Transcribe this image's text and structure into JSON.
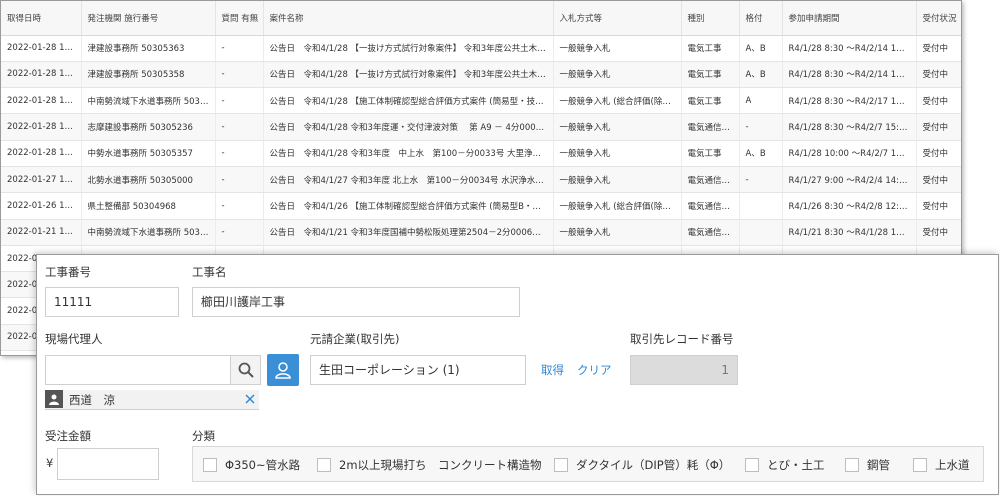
{
  "table": {
    "headers": [
      "取得日時",
      "発注機関 施行番号",
      "質問 有無",
      "案件名称",
      "入札方式等",
      "種別",
      "格付",
      "参加申請期間",
      "受付状況"
    ],
    "rows": [
      [
        "2022-01-28 12:01",
        "津建設事務所 50305363",
        "-",
        "公告日　令和4/1/28 【一抜け方式試行対象案件】 令和3年度公共土木施設維…",
        "一般競争入札",
        "電気工事",
        "A、B",
        "R4/1/28 8:30 ～R4/2/14 16:00",
        "受付中"
      ],
      [
        "2022-01-28 12:01",
        "津建設事務所 50305358",
        "-",
        "公告日　令和4/1/28 【一抜け方式試行対象案件】 令和3年度公共土木施設維…",
        "一般競争入札",
        "電気工事",
        "A、B",
        "R4/1/28 8:30 ～R4/2/14 16:00",
        "受付中"
      ],
      [
        "2022-01-28 12:01",
        "中南勢流域下水道事務所 50305…",
        "-",
        "公告日　令和4/1/28 【施工体制確認型総合評価方式案件 (簡易型・技術資料…",
        "一般競争入札 (総合評価(除算))",
        "電気工事",
        "A",
        "R4/1/28 8:30 ～R4/2/17 15:00",
        "受付中"
      ],
      [
        "2022-01-28 12:01",
        "志摩建設事務所 50305236",
        "-",
        "公告日　令和4/1/28 令和3年度運・交付津波対策　 第 A9 － 4分0001号 片…",
        "一般競争入札",
        "電気通信…",
        "-",
        "R4/1/28 8:30 ～R4/2/7 15:00",
        "受付中"
      ],
      [
        "2022-01-28 12:01",
        "中勢水道事務所 50305357",
        "-",
        "公告日　令和4/1/28 令和3年度　中上水　第100－分0033号 大里浄水場直流…",
        "一般競争入札",
        "電気工事",
        "A、B",
        "R4/1/28 10:00 ～R4/2/7 10:00",
        "受付中"
      ],
      [
        "2022-01-27 12:01",
        "北勢水道事務所 50305000",
        "-",
        "公告日　令和4/1/27 令和3年度 北上水　第100－分0034号 水沢浄水場電話…",
        "一般競争入札",
        "電気通信…",
        "-",
        "R4/1/27 9:00 ～R4/2/4 14:00",
        "受付中"
      ],
      [
        "2022-01-26 12:01",
        "県土整備部 50304968",
        "-",
        "公告日　令和4/1/26 【施工体制確認型総合評価方式案件 (簡易型B・技術資…",
        "一般競争入札 (総合評価(除算))",
        "電気通信…",
        "",
        "R4/1/26 8:30 ～R4/2/8 12:00",
        "受付中"
      ],
      [
        "2022-01-21 12:01",
        "中南勢流域下水道事務所 50304…",
        "-",
        "公告日　令和4/1/21 令和3年度国補中勢松阪処理第2504－2分0006号 中勢沿…",
        "一般競争入札",
        "電気通信…",
        "",
        "R4/1/21 8:30 ～R4/1/28 15:00",
        "受付中"
      ],
      [
        "2022-0",
        "",
        "",
        "",
        "",
        "",
        "",
        "",
        ""
      ],
      [
        "2022-0",
        "",
        "",
        "",
        "",
        "",
        "",
        "",
        ""
      ],
      [
        "2022-0",
        "",
        "",
        "",
        "",
        "",
        "",
        "",
        ""
      ],
      [
        "2022-0",
        "",
        "",
        "",
        "",
        "",
        "",
        "",
        ""
      ]
    ]
  },
  "form": {
    "project_no_label": "工事番号",
    "project_no_value": "11111",
    "project_name_label": "工事名",
    "project_name_value": "櫛田川護岸工事",
    "site_agent_label": "現場代理人",
    "site_agent_value": "",
    "selected_person": "西道　涼",
    "client_label": "元請企業(取引先)",
    "client_value": "生田コーポレーション (1)",
    "get_link": "取得",
    "clear_link": "クリア",
    "record_no_label": "取引先レコード番号",
    "record_no_value": "1",
    "amount_label": "受注金額",
    "currency_symbol": "¥",
    "amount_value": "",
    "category_label": "分類",
    "categories": [
      "Φ350~管水路",
      "2m以上現場打ち　コンクリート構造物",
      "ダクタイル（DIP管）耗（Φ）",
      "とび・土工",
      "鋼管",
      "上水道"
    ]
  },
  "colors": {
    "accent": "#3a8fd6",
    "link": "#2f86d4",
    "disabled_field": "#dcdcdc"
  },
  "icons": {
    "search": "search-icon",
    "person": "person-icon",
    "close": "close-icon"
  }
}
